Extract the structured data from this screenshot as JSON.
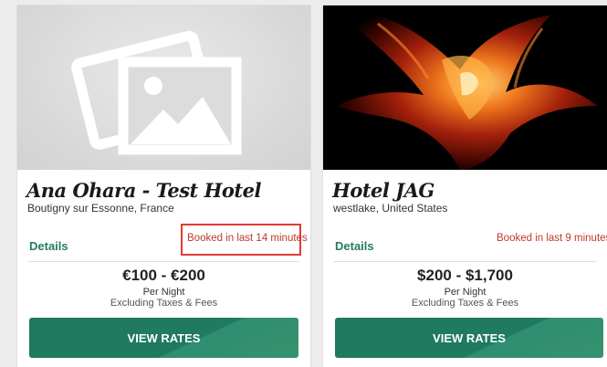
{
  "hotels": [
    {
      "name": "Ana Ohara - Test Hotel",
      "location": "Boutigny sur Essonne, France",
      "details_label": "Details",
      "booked_text": "Booked in last 14 minutes",
      "price": "€100 - €200",
      "per_night": "Per Night",
      "taxes_note": "Excluding Taxes & Fees",
      "button_label": "VIEW RATES",
      "image": "image-placeholder-icon"
    },
    {
      "name": "Hotel JAG",
      "location": "westlake, United States",
      "details_label": "Details",
      "booked_text": "Booked in last 9 minutes",
      "price": "$200 - $1,700",
      "per_night": "Per Night",
      "taxes_note": "Excluding Taxes & Fees",
      "button_label": "VIEW RATES",
      "image": "phoenix-photo"
    }
  ],
  "colors": {
    "accent_green": "#1f7a5f",
    "details_green": "#2a7a62",
    "booked_red": "#c0392b",
    "highlight_red": "#e53935"
  }
}
